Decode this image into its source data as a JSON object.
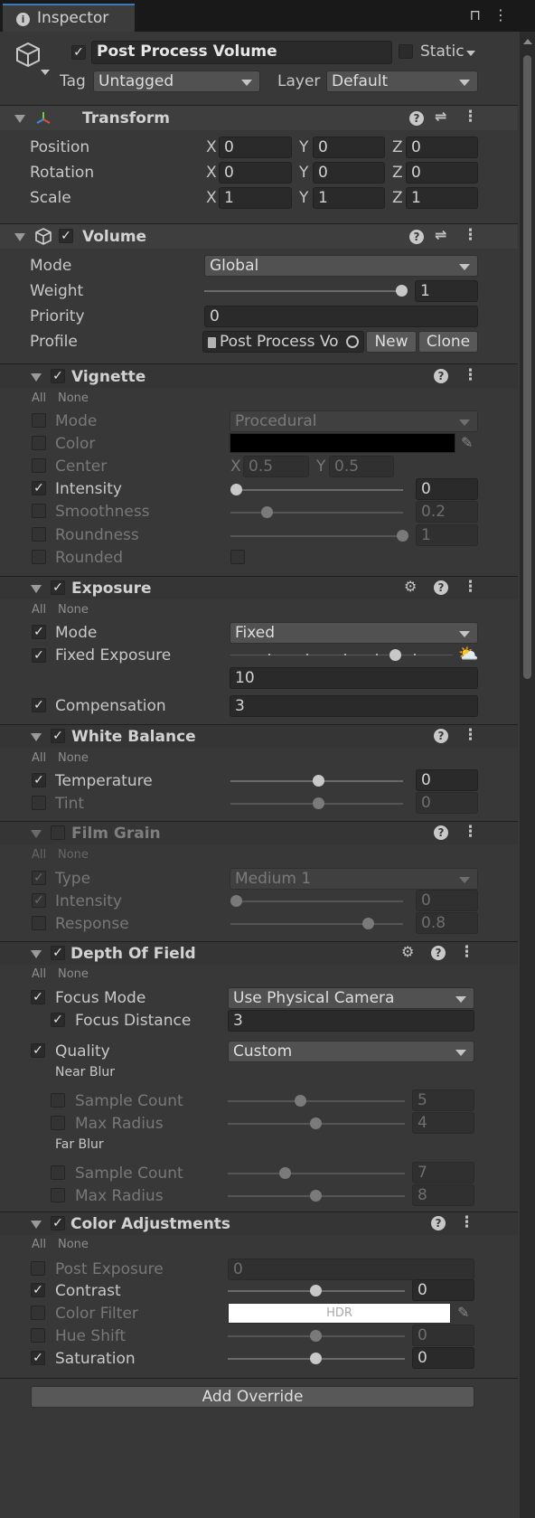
{
  "tab": {
    "title": "Inspector"
  },
  "object": {
    "enabled": true,
    "name": "Post Process Volume",
    "static_label": "Static",
    "tag_label": "Tag",
    "tag_value": "Untagged",
    "layer_label": "Layer",
    "layer_value": "Default"
  },
  "transform": {
    "title": "Transform",
    "rows": [
      {
        "label": "Position",
        "x": "0",
        "y": "0",
        "z": "0"
      },
      {
        "label": "Rotation",
        "x": "0",
        "y": "0",
        "z": "0"
      },
      {
        "label": "Scale",
        "x": "1",
        "y": "1",
        "z": "1"
      }
    ],
    "axis": {
      "x": "X",
      "y": "Y",
      "z": "Z"
    }
  },
  "volume": {
    "title": "Volume",
    "mode_label": "Mode",
    "mode_value": "Global",
    "weight_label": "Weight",
    "weight_value": "1",
    "weight_fraction": 1.0,
    "priority_label": "Priority",
    "priority_value": "0",
    "profile_label": "Profile",
    "profile_value": "Post Process Vo",
    "new_label": "New",
    "clone_label": "Clone"
  },
  "all_label": "All",
  "none_label": "None",
  "vignette": {
    "title": "Vignette",
    "mode": {
      "label": "Mode",
      "value": "Procedural"
    },
    "color": {
      "label": "Color",
      "hex": "#000000"
    },
    "center": {
      "label": "Center",
      "x": "0.5",
      "y": "0.5"
    },
    "intensity": {
      "label": "Intensity",
      "value": "0"
    },
    "smoothness": {
      "label": "Smoothness",
      "value": "0.2"
    },
    "roundness": {
      "label": "Roundness",
      "value": "1"
    },
    "rounded": {
      "label": "Rounded"
    }
  },
  "exposure": {
    "title": "Exposure",
    "mode": {
      "label": "Mode",
      "value": "Fixed"
    },
    "fixed": {
      "label": "Fixed Exposure",
      "value": "10"
    },
    "compensation": {
      "label": "Compensation",
      "value": "3"
    }
  },
  "white_balance": {
    "title": "White Balance",
    "temperature": {
      "label": "Temperature",
      "value": "0"
    },
    "tint": {
      "label": "Tint",
      "value": "0"
    }
  },
  "film_grain": {
    "title": "Film Grain",
    "type": {
      "label": "Type",
      "value": "Medium 1"
    },
    "intensity": {
      "label": "Intensity",
      "value": "0"
    },
    "response": {
      "label": "Response",
      "value": "0.8"
    }
  },
  "dof": {
    "title": "Depth Of Field",
    "focus_mode": {
      "label": "Focus Mode",
      "value": "Use Physical Camera"
    },
    "focus_distance": {
      "label": "Focus Distance",
      "value": "3"
    },
    "quality": {
      "label": "Quality",
      "value": "Custom"
    },
    "near_blur": "Near Blur",
    "far_blur": "Far Blur",
    "near_sample": {
      "label": "Sample Count",
      "value": "5"
    },
    "near_radius": {
      "label": "Max Radius",
      "value": "4"
    },
    "far_sample": {
      "label": "Sample Count",
      "value": "7"
    },
    "far_radius": {
      "label": "Max Radius",
      "value": "8"
    }
  },
  "color_adj": {
    "title": "Color Adjustments",
    "post_exposure": {
      "label": "Post Exposure",
      "value": "0"
    },
    "contrast": {
      "label": "Contrast",
      "value": "0"
    },
    "color_filter": {
      "label": "Color Filter",
      "hdr": "HDR"
    },
    "hue_shift": {
      "label": "Hue Shift",
      "value": "0"
    },
    "saturation": {
      "label": "Saturation",
      "value": "0"
    }
  },
  "add_override": "Add Override"
}
